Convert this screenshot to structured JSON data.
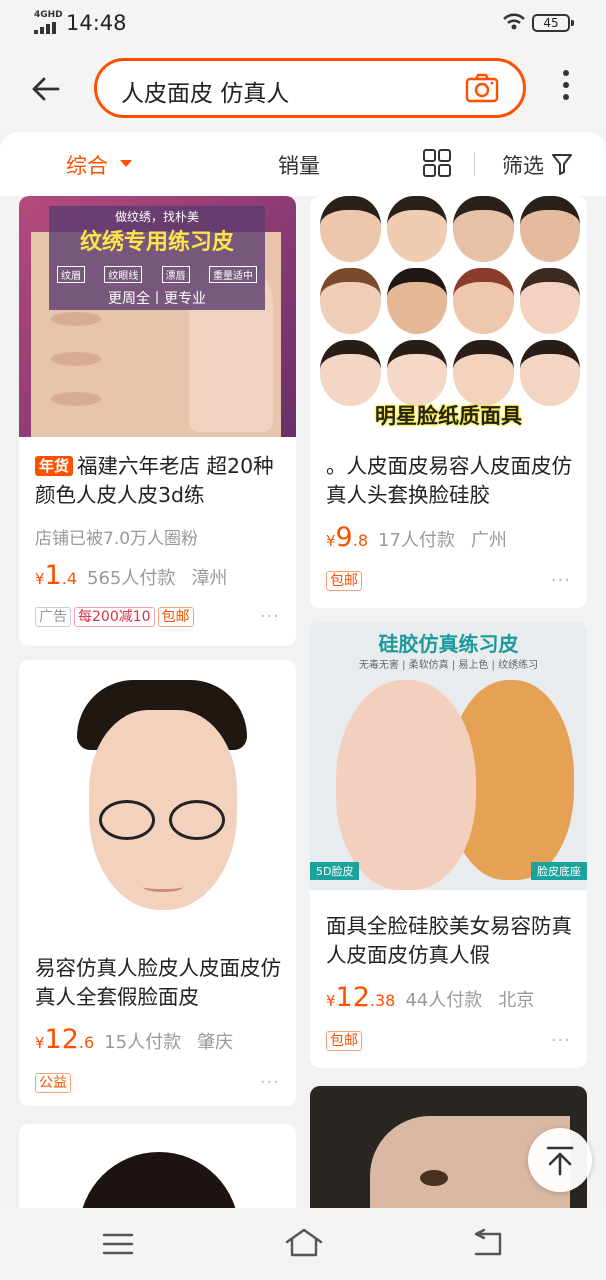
{
  "status_bar": {
    "network": "4GHD",
    "time": "14:48",
    "battery": "45"
  },
  "search": {
    "query": "人皮面皮 仿真人"
  },
  "sort": {
    "comprehensive": "综合",
    "sales": "销量",
    "filter": "筛选"
  },
  "products": [
    {
      "image": {
        "banner_title": "纹绣专用练习皮",
        "banner_top": "做纹绣，找朴美",
        "banner_tags": [
          "纹眉",
          "纹眼线",
          "漂唇",
          "重量适中"
        ],
        "banner_bottom": "更周全丨更专业"
      },
      "badge": "年货",
      "title": "福建六年老店 超20种颜色人皮人皮3d练",
      "followers": "店铺已被7.0万人圈粉",
      "price_currency": "¥",
      "price_int": "1",
      "price_dec": ".4",
      "sales": "565人付款",
      "location": "漳州",
      "tags": [
        "广告",
        "每200减10",
        "包邮"
      ],
      "more": "···"
    },
    {
      "image": {
        "caption": "明星脸纸质面具"
      },
      "title": "。人皮面皮易容人皮面皮仿真人头套换脸硅胶",
      "price_currency": "¥",
      "price_int": "9",
      "price_dec": ".8",
      "sales": "17人付款",
      "location": "广州",
      "tags": [
        "包邮"
      ],
      "more": "···"
    },
    {
      "title": "易容仿真人脸皮人皮面皮仿真人全套假脸面皮",
      "price_currency": "¥",
      "price_int": "12",
      "price_dec": ".6",
      "sales": "15人付款",
      "location": "肇庆",
      "tags": [
        "公益"
      ],
      "more": "···"
    },
    {
      "image": {
        "headline": "硅胶仿真练习皮",
        "subline": "无毒无害 | 柔软仿真 | 易上色 | 纹绣练习",
        "left_label": "5D脸皮",
        "right_label": "脸皮底座"
      },
      "title": "面具全脸硅胶美女易容防真人皮面皮仿真人假",
      "price_currency": "¥",
      "price_int": "12",
      "price_dec": ".38",
      "sales": "44人付款",
      "location": "北京",
      "tags": [
        "包邮"
      ],
      "more": "···"
    }
  ]
}
